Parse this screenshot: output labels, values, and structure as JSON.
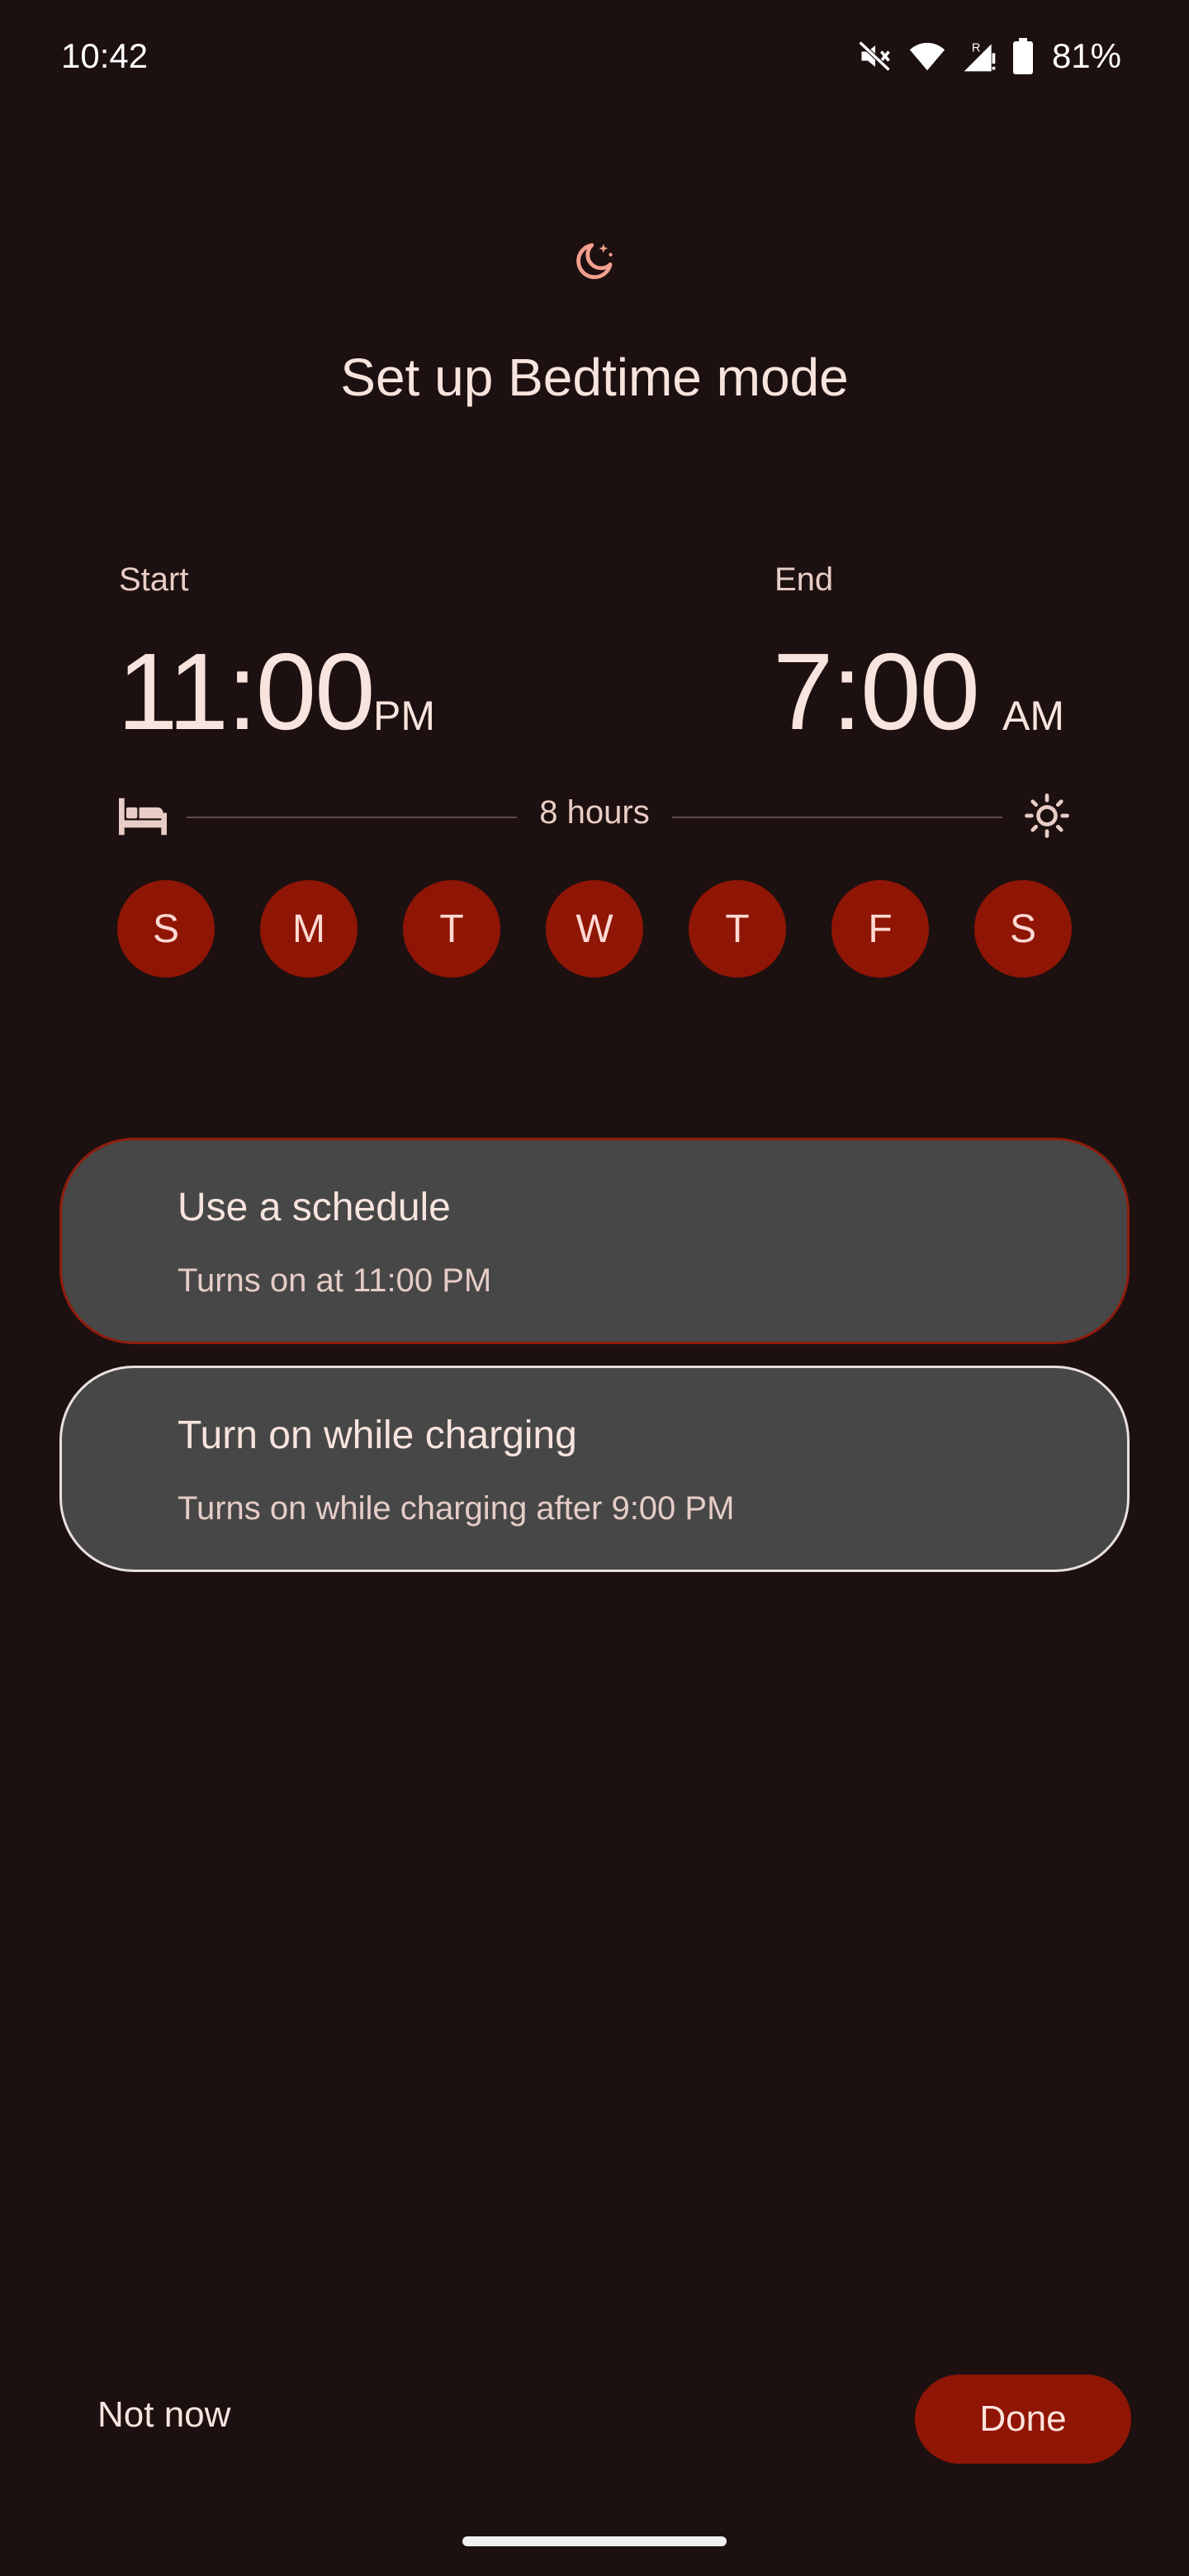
{
  "status_bar": {
    "time": "10:42",
    "battery": "81%",
    "icons": [
      "mute-icon",
      "wifi-icon",
      "signal-icon",
      "battery-icon"
    ]
  },
  "header": {
    "icon": "bedtime-moon-icon",
    "title": "Set up Bedtime mode"
  },
  "schedule": {
    "start_label": "Start",
    "start_time": "11:00",
    "start_ampm": "PM",
    "end_label": "End",
    "end_time": "7:00",
    "end_ampm": "AM",
    "duration": "8 hours",
    "days": [
      "S",
      "M",
      "T",
      "W",
      "T",
      "F",
      "S"
    ]
  },
  "options": [
    {
      "title": "Use a schedule",
      "subtitle": "Turns on at 11:00 PM",
      "selected": true
    },
    {
      "title": "Turn on while charging",
      "subtitle": "Turns on while charging after 9:00 PM",
      "selected": false
    }
  ],
  "footer": {
    "not_now": "Not now",
    "done": "Done"
  },
  "colors": {
    "background": "#1d1010",
    "accent": "#8f1505",
    "card": "#474747",
    "text": "#f8e4de"
  }
}
